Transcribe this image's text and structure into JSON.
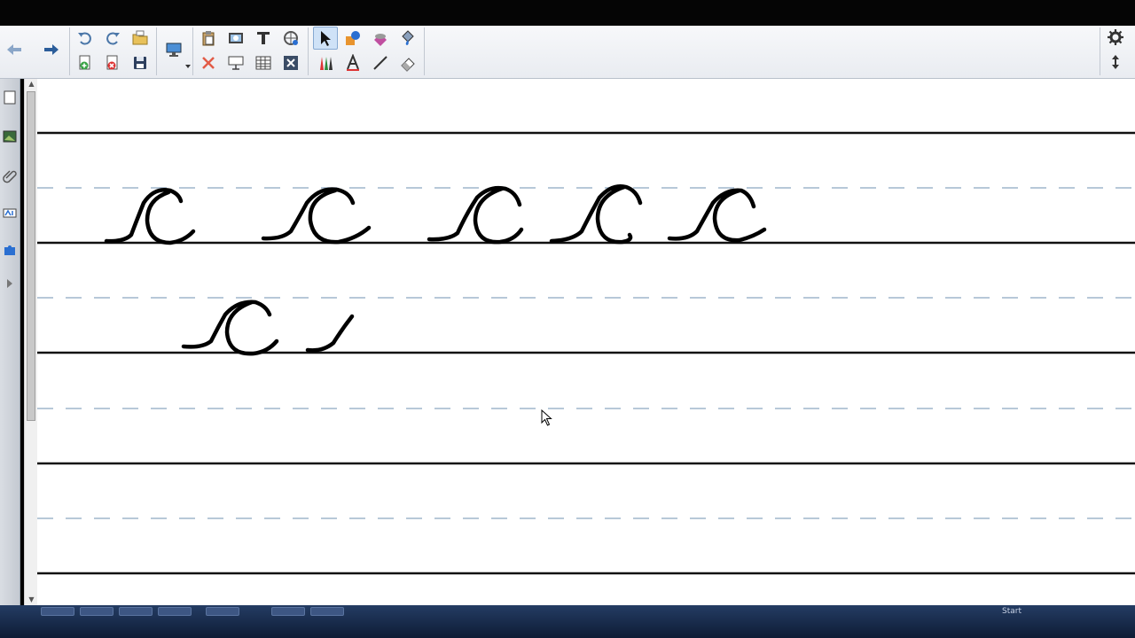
{
  "toolbar": {
    "nav": [
      "back-arrow-icon",
      "forward-arrow-icon"
    ],
    "groups": [
      [
        "undo-icon",
        "redo-icon",
        "open-folder-icon",
        "add-page-icon",
        "delete-page-icon",
        "save-icon"
      ],
      [
        "screen-display-icon"
      ],
      [
        "paste-icon",
        "capture-icon",
        "text-tool-icon",
        "magic-pen-icon",
        "clear-icon",
        "screen-shade-icon",
        "table-icon",
        "close-box-icon"
      ],
      [
        "select-pointer-icon",
        "shapes-icon",
        "eraser-fill-icon",
        "fill-bucket-icon",
        "pens-icon",
        "text-a-icon",
        "line-icon",
        "eraser-icon"
      ]
    ],
    "right": [
      "gear-icon",
      "move-toolbar-icon"
    ],
    "active_tool": "select-pointer-icon"
  },
  "sidebar": {
    "tabs": [
      "page-sorter-icon",
      "gallery-icon",
      "attachments-icon",
      "properties-icon",
      "addons-icon",
      "collapse-icon"
    ]
  },
  "canvas": {
    "pen_color": "#000000",
    "guideline_solid_color": "#000000",
    "guideline_dashed_color": "#9fb6cc",
    "rows_written": [
      {
        "letter": "c",
        "count": 5
      },
      {
        "letter": "c",
        "count": 1,
        "partial_stroke": true
      }
    ]
  },
  "taskbar": {
    "tray_text": "Start"
  },
  "colors": {
    "accent": "#2a6fd1",
    "active_tool_bg": "#cfe2f7"
  }
}
